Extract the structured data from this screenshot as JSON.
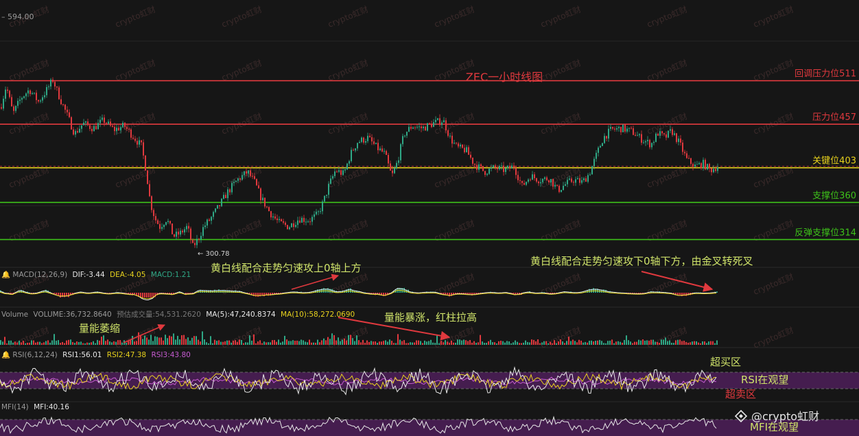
{
  "price_panel": {
    "top_price_label": "594.00",
    "low_price_label": "← 300.78",
    "title": "ZEC一小时线图"
  },
  "levels": [
    {
      "id": "level-511",
      "label": "回调压力位511",
      "price": 511,
      "color": "#e0393e"
    },
    {
      "id": "level-457",
      "label": "压力位457",
      "price": 457,
      "color": "#e0393e"
    },
    {
      "id": "level-403",
      "label": "关键位403",
      "price": 403,
      "color": "#e8d21d"
    },
    {
      "id": "level-360",
      "label": "支撑位360",
      "price": 360,
      "color": "#3ec21a"
    },
    {
      "id": "level-314",
      "label": "反弹支撑位314",
      "price": 314,
      "color": "#3ec21a"
    }
  ],
  "annotations": {
    "macd_up": "黄白线配合走势匀速攻上0轴上方",
    "macd_down": "黄白线配合走势匀速攻下0轴下方，由金叉转死叉",
    "vol_shrink": "量能萎缩",
    "vol_surge": "量能暴涨，红柱拉高",
    "overbought": "超买区",
    "rsi_watch": "RSI在观望",
    "oversold": "超卖区",
    "mfi_watch": "MFI在观望"
  },
  "macd_header": {
    "name": "MACD(12,26,9)",
    "dif": "DIF:-3.44",
    "dea": "DEA:-4.05",
    "macd": "MACD:1.21"
  },
  "volume_header": {
    "name": "Volume",
    "volume": "VOLUME:36,732.8640",
    "estimate": "预估成交量:54,531.2620",
    "ma5": "MA(5):47,240.8374",
    "ma10": "MA(10):58,272.0690"
  },
  "rsi_header": {
    "name": "RSI(6,12,24)",
    "rsi1": "RSI1:56.01",
    "rsi2": "RSI2:47.38",
    "rsi3": "RSI3:43.80"
  },
  "mfi_header": {
    "name": "MFI(14)",
    "mfi": "MFI:40.16"
  },
  "watermark": {
    "text": "crypto虹财",
    "brand": "@crypto虹财"
  },
  "colors": {
    "up": "#2fa886",
    "down": "#e0393e",
    "yellow": "#e8d21d",
    "annotation_green": "#cfe36a",
    "annotation_red": "#e0393e",
    "zone_purple": "#4a1e55"
  },
  "chart_data": {
    "type": "candlestick",
    "title": "ZEC一小时线图",
    "y_range": [
      300.78,
      594.0
    ],
    "price_path": [
      [
        0,
        478
      ],
      [
        8,
        505
      ],
      [
        18,
        470
      ],
      [
        30,
        490
      ],
      [
        42,
        500
      ],
      [
        55,
        485
      ],
      [
        66,
        498
      ],
      [
        76,
        512
      ],
      [
        86,
        490
      ],
      [
        96,
        470
      ],
      [
        108,
        445
      ],
      [
        120,
        458
      ],
      [
        135,
        452
      ],
      [
        150,
        462
      ],
      [
        165,
        450
      ],
      [
        180,
        455
      ],
      [
        195,
        440
      ],
      [
        205,
        430
      ],
      [
        212,
        400
      ],
      [
        218,
        360
      ],
      [
        225,
        340
      ],
      [
        232,
        330
      ],
      [
        242,
        340
      ],
      [
        252,
        318
      ],
      [
        262,
        322
      ],
      [
        272,
        330
      ],
      [
        280,
        305
      ],
      [
        288,
        315
      ],
      [
        296,
        330
      ],
      [
        306,
        340
      ],
      [
        318,
        355
      ],
      [
        330,
        372
      ],
      [
        345,
        388
      ],
      [
        360,
        398
      ],
      [
        370,
        385
      ],
      [
        380,
        365
      ],
      [
        392,
        348
      ],
      [
        405,
        335
      ],
      [
        420,
        330
      ],
      [
        435,
        340
      ],
      [
        450,
        338
      ],
      [
        462,
        345
      ],
      [
        470,
        360
      ],
      [
        478,
        380
      ],
      [
        488,
        400
      ],
      [
        500,
        395
      ],
      [
        510,
        420
      ],
      [
        520,
        435
      ],
      [
        535,
        440
      ],
      [
        548,
        428
      ],
      [
        560,
        420
      ],
      [
        570,
        392
      ],
      [
        578,
        410
      ],
      [
        588,
        445
      ],
      [
        600,
        455
      ],
      [
        615,
        452
      ],
      [
        630,
        458
      ],
      [
        645,
        462
      ],
      [
        655,
        440
      ],
      [
        665,
        428
      ],
      [
        678,
        425
      ],
      [
        690,
        408
      ],
      [
        705,
        398
      ],
      [
        720,
        403
      ],
      [
        735,
        400
      ],
      [
        748,
        405
      ],
      [
        760,
        380
      ],
      [
        772,
        393
      ],
      [
        785,
        388
      ],
      [
        800,
        390
      ],
      [
        812,
        375
      ],
      [
        822,
        382
      ],
      [
        835,
        388
      ],
      [
        848,
        385
      ],
      [
        858,
        396
      ],
      [
        868,
        418
      ],
      [
        878,
        440
      ],
      [
        890,
        450
      ],
      [
        905,
        452
      ],
      [
        920,
        448
      ],
      [
        935,
        438
      ],
      [
        948,
        432
      ],
      [
        958,
        446
      ],
      [
        968,
        440
      ],
      [
        978,
        449
      ],
      [
        990,
        432
      ],
      [
        1000,
        413
      ],
      [
        1012,
        405
      ],
      [
        1024,
        408
      ],
      [
        1034,
        400
      ],
      [
        1045,
        405
      ]
    ],
    "low_marker": {
      "price": 300.78
    }
  }
}
